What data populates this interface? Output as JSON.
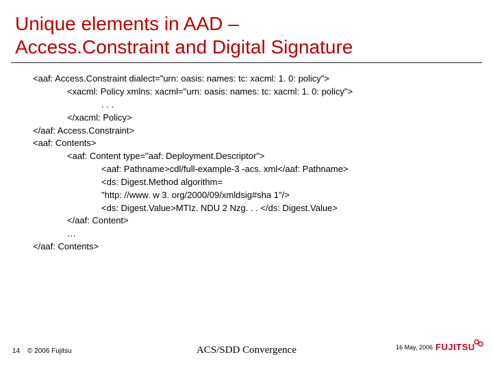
{
  "title_line1": "Unique elements in AAD –",
  "title_line2": "Access.Constraint and Digital Signature",
  "code": {
    "l0_0": "<aaf: Access.Constraint dialect=\"urn: oasis: names: tc: xacml: 1. 0: policy\">",
    "l1_0": "<xacml: Policy xmlns: xacml=\"urn: oasis: names: tc: xacml: 1. 0: policy\">",
    "l2_0": ". . .",
    "l1_1": "</xacml: Policy>",
    "l0_1": "</aaf: Access.Constraint>",
    "l0_2": "<aaf: Contents>",
    "l1_2": "<aaf: Content type=\"aaf: Deployment.Descriptor\">",
    "l2_1": "<aaf: Pathname>cdl/full-example-3 -acs. xml</aaf: Pathname>",
    "l2_2": "<ds: Digest.Method algorithm=",
    "l2_3": "\"http: //www. w 3. org/2000/09/xmldsig#sha 1\"/>",
    "l2_4": "<ds: Digest.Value>MTIz. NDU 2 Nzg. . . </ds: Digest.Value>",
    "l1_3": "</aaf: Content>",
    "l1_4": "…",
    "l0_3": "</aaf: Contents>"
  },
  "footer": {
    "page": "14",
    "copyright": "© 2006 Fujitsu",
    "center": "ACS/SDD Convergence",
    "date": "16 May, 2006"
  },
  "logo": {
    "text": "FUJITSU",
    "color": "#c40022"
  }
}
